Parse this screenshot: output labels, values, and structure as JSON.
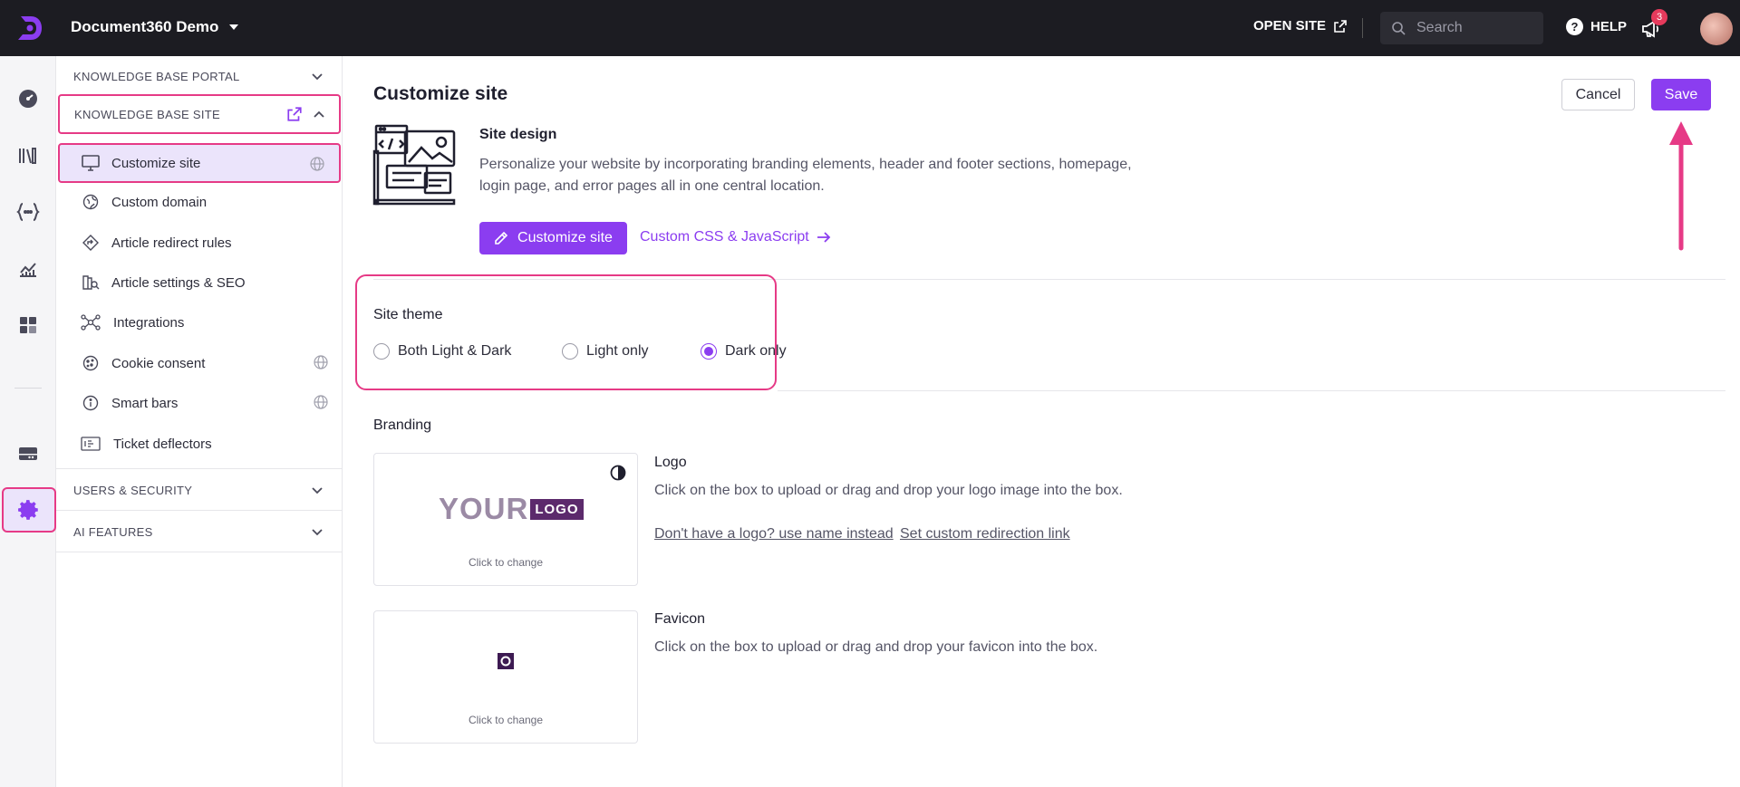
{
  "topbar": {
    "project_name": "Document360 Demo",
    "open_site_label": "OPEN SITE",
    "search_placeholder": "Search",
    "help_label": "HELP",
    "notification_count": "3",
    "brand_color": "#8b3df0"
  },
  "rail": {
    "icons": [
      "dashboard-icon",
      "documentation-icon",
      "api-docs-icon",
      "analytics-icon",
      "widgets-icon",
      "drive-icon",
      "settings-icon"
    ],
    "active": "settings-icon"
  },
  "sidebar": {
    "sections": {
      "kb_portal": "KNOWLEDGE BASE PORTAL",
      "kb_site": "KNOWLEDGE BASE SITE",
      "users_security": "USERS & SECURITY",
      "ai_features": "AI FEATURES"
    },
    "items": [
      {
        "label": "Customize site",
        "icon": "monitor-icon",
        "globe": true,
        "active": true
      },
      {
        "label": "Custom domain",
        "icon": "domain-icon",
        "globe": false,
        "active": false
      },
      {
        "label": "Article redirect rules",
        "icon": "redirect-icon",
        "globe": false,
        "active": false
      },
      {
        "label": "Article settings & SEO",
        "icon": "seo-icon",
        "globe": false,
        "active": false
      },
      {
        "label": "Integrations",
        "icon": "integrations-icon",
        "globe": false,
        "active": false
      },
      {
        "label": "Cookie consent",
        "icon": "cookie-icon",
        "globe": true,
        "active": false
      },
      {
        "label": "Smart bars",
        "icon": "info-icon",
        "globe": true,
        "active": false
      },
      {
        "label": "Ticket deflectors",
        "icon": "ticket-icon",
        "globe": false,
        "active": false
      }
    ]
  },
  "main": {
    "title": "Customize site",
    "cancel_label": "Cancel",
    "save_label": "Save",
    "site_design": {
      "title": "Site design",
      "description": "Personalize your website by incorporating branding elements, header and footer sections, homepage, login page, and error pages all in one central location.",
      "customize_button": "Customize site",
      "css_link": "Custom CSS & JavaScript"
    },
    "site_theme": {
      "title": "Site theme",
      "options": [
        "Both Light & Dark",
        "Light only",
        "Dark only"
      ],
      "selected": "Dark only"
    },
    "branding": {
      "title": "Branding",
      "logo": {
        "label": "Logo",
        "description": "Click on the box to upload or drag and drop your logo image into the box.",
        "preview_word": "YOUR",
        "preview_tag": "LOGO",
        "caption": "Click to change",
        "link_use_name": "Don't have a logo? use name instead",
        "link_redirect": "Set custom redirection link"
      },
      "favicon": {
        "label": "Favicon",
        "description": "Click on the box to upload or drag and drop your favicon into the box.",
        "caption": "Click to change"
      }
    }
  },
  "colors": {
    "accent": "#8b3df0",
    "highlight": "#e63a86",
    "topbar_bg": "#1c1c22"
  }
}
